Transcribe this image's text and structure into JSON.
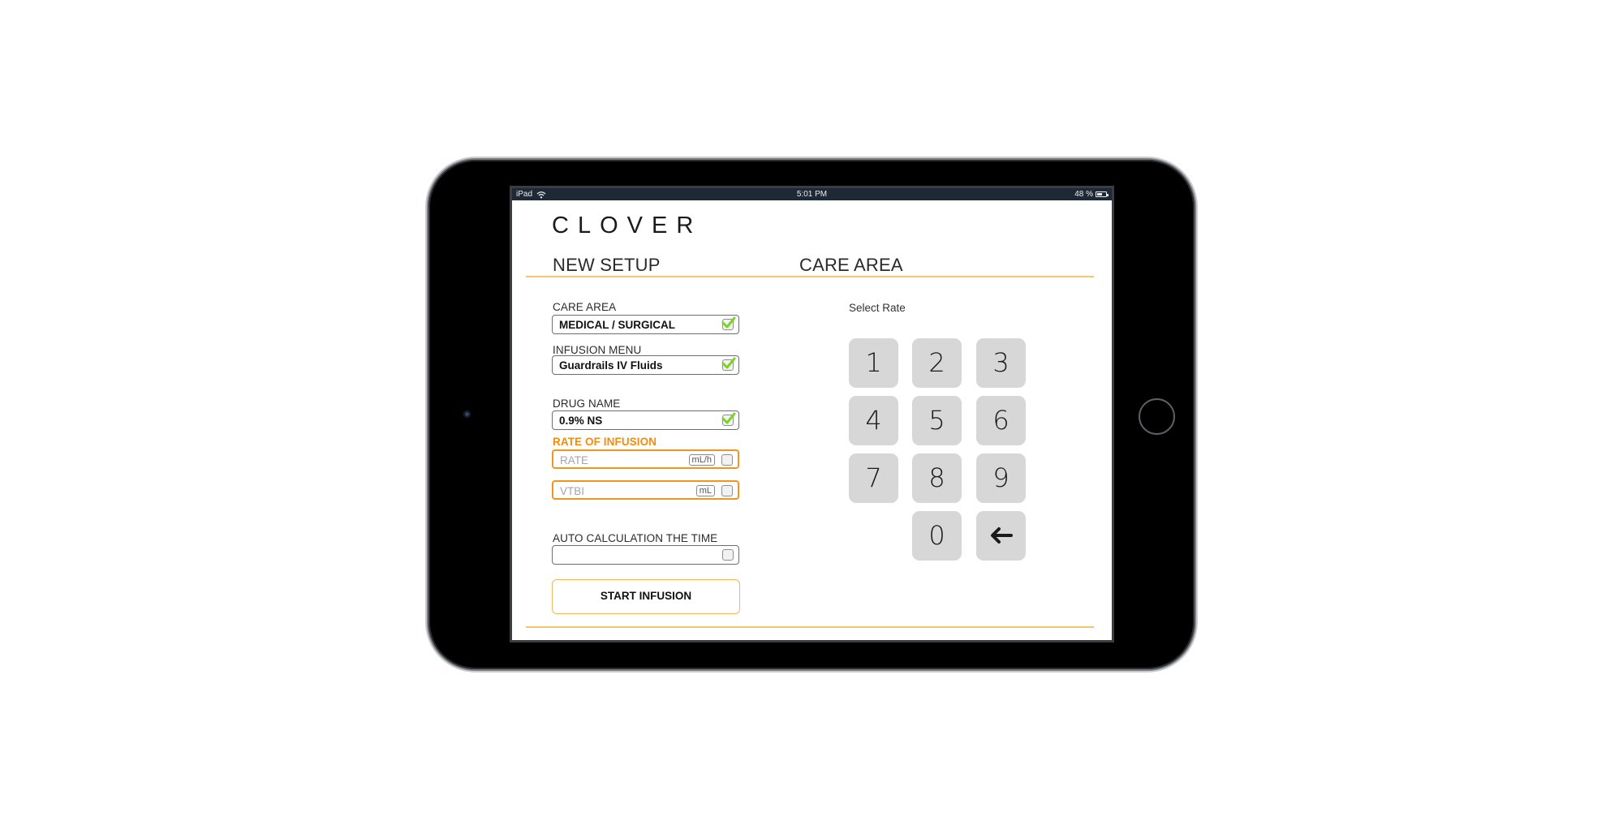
{
  "status_bar": {
    "device": "iPad",
    "time": "5:01 PM",
    "battery": "48 %",
    "battery_level": 0.48
  },
  "app": {
    "logo": "CLOVER"
  },
  "header": {
    "left_title": "NEW SETUP",
    "right_title": "CARE AREA"
  },
  "form": {
    "care_area": {
      "label": "CARE AREA",
      "value": "MEDICAL / SURGICAL",
      "checked": true
    },
    "infusion_menu": {
      "label": "INFUSION MENU",
      "value": "Guardrails IV Fluids",
      "checked": true
    },
    "drug_name": {
      "label": "DRUG NAME",
      "value": "0.9% NS",
      "checked": true
    },
    "rate_of_infusion_label": "RATE OF INFUSION",
    "rate": {
      "placeholder": "RATE",
      "unit": "mL/h",
      "checked": false
    },
    "vtbi": {
      "placeholder": "VTBI",
      "unit": "mL",
      "checked": false
    },
    "auto_calc": {
      "label": "AUTO CALCULATION THE TIME",
      "value": "",
      "checked": false
    },
    "start_button": "START INFUSION"
  },
  "keypad": {
    "title": "Select Rate",
    "keys": [
      "1",
      "2",
      "3",
      "4",
      "5",
      "6",
      "7",
      "8",
      "9",
      "0"
    ],
    "backspace_icon": "left-arrow"
  },
  "colors": {
    "accent_orange": "#f29420",
    "rule_orange": "#f7c36e",
    "check_green": "#7ed321",
    "key_gray": "#d7d7d7",
    "status_bar": "#1f2935"
  }
}
